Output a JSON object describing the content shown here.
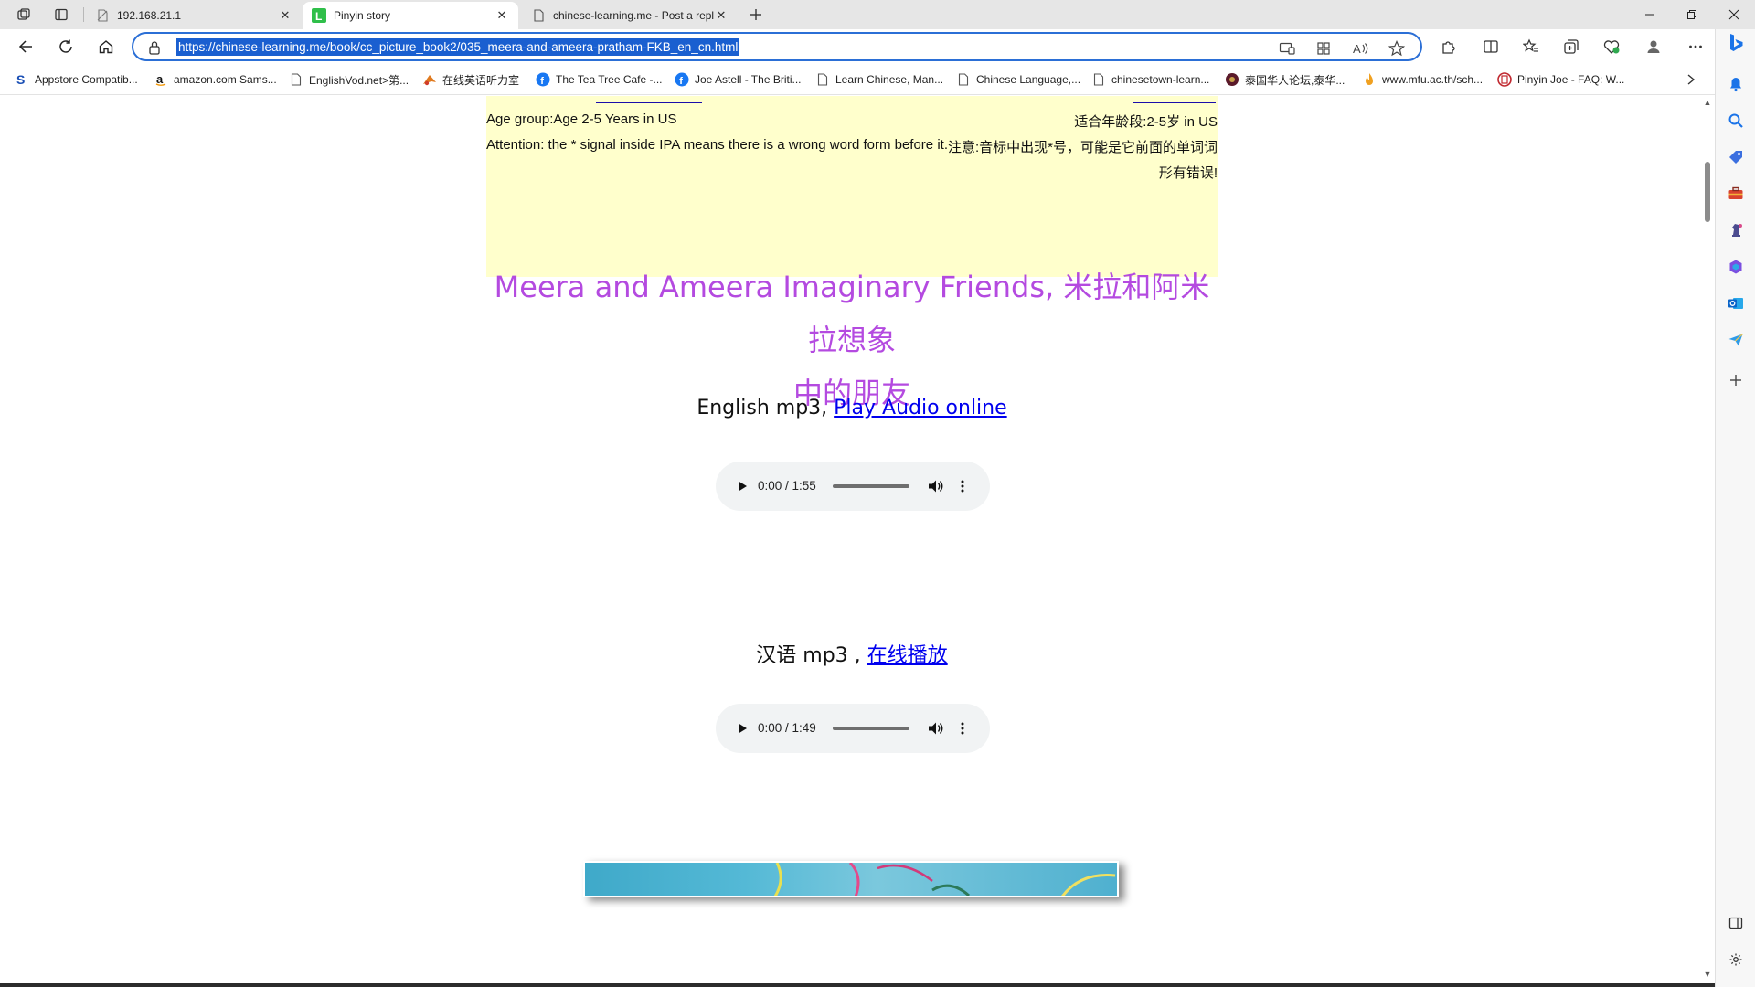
{
  "tabs": [
    {
      "title": "192.168.21.1",
      "active": false
    },
    {
      "title": "Pinyin story",
      "active": true
    },
    {
      "title": "chinese-learning.me - Post a repl",
      "active": false
    }
  ],
  "address": {
    "url": "https://chinese-learning.me/book/cc_picture_book2/035_meera-and-ameera-pratham-FKB_en_cn.html"
  },
  "bookmarks": [
    {
      "label": "Appstore Compatib...",
      "icon": "s-icon"
    },
    {
      "label": "amazon.com Sams...",
      "icon": "amazon-icon"
    },
    {
      "label": "EnglishVod.net>第...",
      "icon": "page-icon"
    },
    {
      "label": "在线英语听力室",
      "icon": "bird-icon"
    },
    {
      "label": "The Tea Tree Cafe -...",
      "icon": "facebook-icon"
    },
    {
      "label": "Joe Astell - The Briti...",
      "icon": "facebook-icon"
    },
    {
      "label": "Learn Chinese, Man...",
      "icon": "page-icon"
    },
    {
      "label": "Chinese Language,...",
      "icon": "page-icon"
    },
    {
      "label": "chinesetown-learn...",
      "icon": "page-icon"
    },
    {
      "label": "泰国华人论坛,泰华...",
      "icon": "circle-icon"
    },
    {
      "label": "www.mfu.ac.th/sch...",
      "icon": "flame-icon"
    },
    {
      "label": "Pinyin Joe - FAQ: W...",
      "icon": "pinyin-icon"
    }
  ],
  "info": {
    "age_en": "Age group:Age 2-5 Years in US",
    "age_cn": "适合年龄段:2-5岁 in US",
    "attention_en": "Attention: the * signal inside IPA means there is a wrong word form before it.",
    "attention_cn_1": "注意:音标中出现*号，可能是它前面的单词词",
    "attention_cn_2": "形有错误!"
  },
  "story": {
    "title_line1": "Meera and Ameera Imaginary Friends, 米拉和阿米拉想象",
    "title_line2": "中的朋友"
  },
  "audio": [
    {
      "label": "English mp3, ",
      "link": "Play Audio online",
      "time": "0:00 / 1:55"
    },
    {
      "label": "汉语 mp3 , ",
      "link": "在线播放",
      "time": "0:00 / 1:49"
    }
  ],
  "colors": {
    "title": "#b44ae0",
    "link": "#0000ee",
    "info_bg": "#ffffcc",
    "accent": "#2b6fd6"
  }
}
